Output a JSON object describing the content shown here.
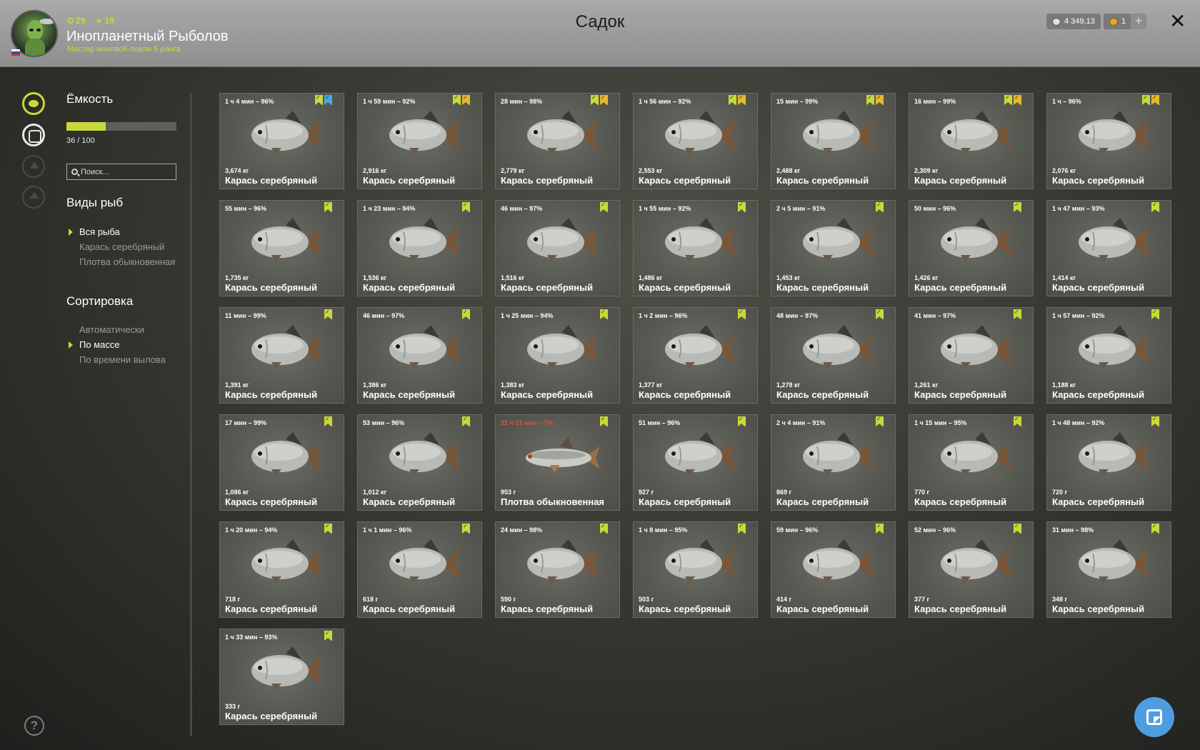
{
  "header": {
    "title": "Садок",
    "player_name": "Инопланетный Рыболов",
    "player_rank": "Мастер маховой ловли 5 ранга",
    "level": "29",
    "stars": "19",
    "silver": "4 349,13",
    "gold": "1",
    "plus_label": "+",
    "close_label": "✕"
  },
  "sidebar": {
    "capacity_title": "Ёмкость",
    "capacity_text": "36 / 100",
    "capacity_fraction": 0.36,
    "search_placeholder": "Поиск...",
    "species_title": "Виды рыб",
    "species": [
      "Вся рыба",
      "Карась серебряный",
      "Плотва обыкновенная"
    ],
    "species_active": 0,
    "sort_title": "Сортировка",
    "sort": [
      "Автоматически",
      "По массе",
      "По времени вылова"
    ],
    "sort_active": 1,
    "help_label": "?"
  },
  "colors": {
    "accent": "#c9d83a",
    "gold": "#e6b92f",
    "blue": "#45a9e6",
    "warning": "#e0503a"
  },
  "fish": [
    {
      "time": "1 ч 4 мин – 96%",
      "weight": "3,674 кг",
      "name": "Карась серебряный",
      "badges": [
        "green",
        "blue"
      ],
      "kind": "crucian"
    },
    {
      "time": "1 ч 59 мин – 92%",
      "weight": "2,916 кг",
      "name": "Карась серебряный",
      "badges": [
        "green",
        "gold"
      ],
      "kind": "crucian"
    },
    {
      "time": "28 мин – 98%",
      "weight": "2,779 кг",
      "name": "Карась серебряный",
      "badges": [
        "green",
        "gold"
      ],
      "kind": "crucian"
    },
    {
      "time": "1 ч 56 мин – 92%",
      "weight": "2,553 кг",
      "name": "Карась серебряный",
      "badges": [
        "green",
        "gold"
      ],
      "kind": "crucian"
    },
    {
      "time": "15 мин – 99%",
      "weight": "2,488 кг",
      "name": "Карась серебряный",
      "badges": [
        "green",
        "gold"
      ],
      "kind": "crucian"
    },
    {
      "time": "16 мин – 99%",
      "weight": "2,309 кг",
      "name": "Карась серебряный",
      "badges": [
        "green",
        "gold"
      ],
      "kind": "crucian"
    },
    {
      "time": "1 ч – 96%",
      "weight": "2,076 кг",
      "name": "Карась серебряный",
      "badges": [
        "green",
        "gold"
      ],
      "kind": "crucian"
    },
    {
      "time": "55 мин – 96%",
      "weight": "1,735 кг",
      "name": "Карась серебряный",
      "badges": [
        "green"
      ],
      "kind": "crucian"
    },
    {
      "time": "1 ч 23 мин – 94%",
      "weight": "1,536 кг",
      "name": "Карась серебряный",
      "badges": [
        "green"
      ],
      "kind": "crucian"
    },
    {
      "time": "46 мин – 97%",
      "weight": "1,516 кг",
      "name": "Карась серебряный",
      "badges": [
        "green"
      ],
      "kind": "crucian"
    },
    {
      "time": "1 ч 55 мин – 92%",
      "weight": "1,486 кг",
      "name": "Карась серебряный",
      "badges": [
        "green"
      ],
      "kind": "crucian"
    },
    {
      "time": "2 ч 5 мин – 91%",
      "weight": "1,453 кг",
      "name": "Карась серебряный",
      "badges": [
        "green"
      ],
      "kind": "crucian"
    },
    {
      "time": "50 мин – 96%",
      "weight": "1,426 кг",
      "name": "Карась серебряный",
      "badges": [
        "green"
      ],
      "kind": "crucian"
    },
    {
      "time": "1 ч 47 мин – 93%",
      "weight": "1,414 кг",
      "name": "Карась серебряный",
      "badges": [
        "green"
      ],
      "kind": "crucian"
    },
    {
      "time": "11 мин – 99%",
      "weight": "1,391 кг",
      "name": "Карась серебряный",
      "badges": [
        "green"
      ],
      "kind": "crucian"
    },
    {
      "time": "46 мин – 97%",
      "weight": "1,386 кг",
      "name": "Карась серебряный",
      "badges": [
        "green"
      ],
      "kind": "crucian"
    },
    {
      "time": "1 ч 25 мин – 94%",
      "weight": "1,383 кг",
      "name": "Карась серебряный",
      "badges": [
        "green"
      ],
      "kind": "crucian"
    },
    {
      "time": "1 ч 2 мин – 96%",
      "weight": "1,377 кг",
      "name": "Карась серебряный",
      "badges": [
        "green"
      ],
      "kind": "crucian"
    },
    {
      "time": "48 мин – 97%",
      "weight": "1,278 кг",
      "name": "Карась серебряный",
      "badges": [
        "green"
      ],
      "kind": "crucian"
    },
    {
      "time": "41 мин – 97%",
      "weight": "1,261 кг",
      "name": "Карась серебряный",
      "badges": [
        "green"
      ],
      "kind": "crucian"
    },
    {
      "time": "1 ч 57 мин – 92%",
      "weight": "1,188 кг",
      "name": "Карась серебряный",
      "badges": [
        "green"
      ],
      "kind": "crucian"
    },
    {
      "time": "17 мин – 99%",
      "weight": "1,086 кг",
      "name": "Карась серебряный",
      "badges": [
        "green"
      ],
      "kind": "crucian"
    },
    {
      "time": "53 мин – 96%",
      "weight": "1,012 кг",
      "name": "Карась серебряный",
      "badges": [
        "green"
      ],
      "kind": "crucian"
    },
    {
      "time": "22 ч 13 мин – 7%",
      "weight": "953 г",
      "name": "Плотва обыкновенная",
      "badges": [
        "green"
      ],
      "kind": "roach",
      "warn": true
    },
    {
      "time": "51 мин – 96%",
      "weight": "927 г",
      "name": "Карась серебряный",
      "badges": [
        "green"
      ],
      "kind": "crucian"
    },
    {
      "time": "2 ч 4 мин – 91%",
      "weight": "869 г",
      "name": "Карась серебряный",
      "badges": [
        "green"
      ],
      "kind": "crucian"
    },
    {
      "time": "1 ч 15 мин – 95%",
      "weight": "770 г",
      "name": "Карась серебряный",
      "badges": [
        "green"
      ],
      "kind": "crucian"
    },
    {
      "time": "1 ч 48 мин – 92%",
      "weight": "720 г",
      "name": "Карась серебряный",
      "badges": [
        "green"
      ],
      "kind": "crucian"
    },
    {
      "time": "1 ч 20 мин – 94%",
      "weight": "718 г",
      "name": "Карась серебряный",
      "badges": [
        "green"
      ],
      "kind": "crucian"
    },
    {
      "time": "1 ч 1 мин – 96%",
      "weight": "618 г",
      "name": "Карась серебряный",
      "badges": [
        "green"
      ],
      "kind": "crucian"
    },
    {
      "time": "24 мин – 98%",
      "weight": "590 г",
      "name": "Карась серебряный",
      "badges": [
        "green"
      ],
      "kind": "crucian"
    },
    {
      "time": "1 ч 8 мин – 95%",
      "weight": "503 г",
      "name": "Карась серебряный",
      "badges": [
        "green"
      ],
      "kind": "crucian"
    },
    {
      "time": "59 мин – 96%",
      "weight": "414 г",
      "name": "Карась серебряный",
      "badges": [
        "green"
      ],
      "kind": "crucian"
    },
    {
      "time": "52 мин – 96%",
      "weight": "377 г",
      "name": "Карась серебряный",
      "badges": [
        "green"
      ],
      "kind": "crucian"
    },
    {
      "time": "31 мин – 98%",
      "weight": "348 г",
      "name": "Карась серебряный",
      "badges": [
        "green"
      ],
      "kind": "crucian"
    },
    {
      "time": "1 ч 33 мин – 93%",
      "weight": "333 г",
      "name": "Карась серебряный",
      "badges": [
        "green"
      ],
      "kind": "crucian"
    }
  ]
}
